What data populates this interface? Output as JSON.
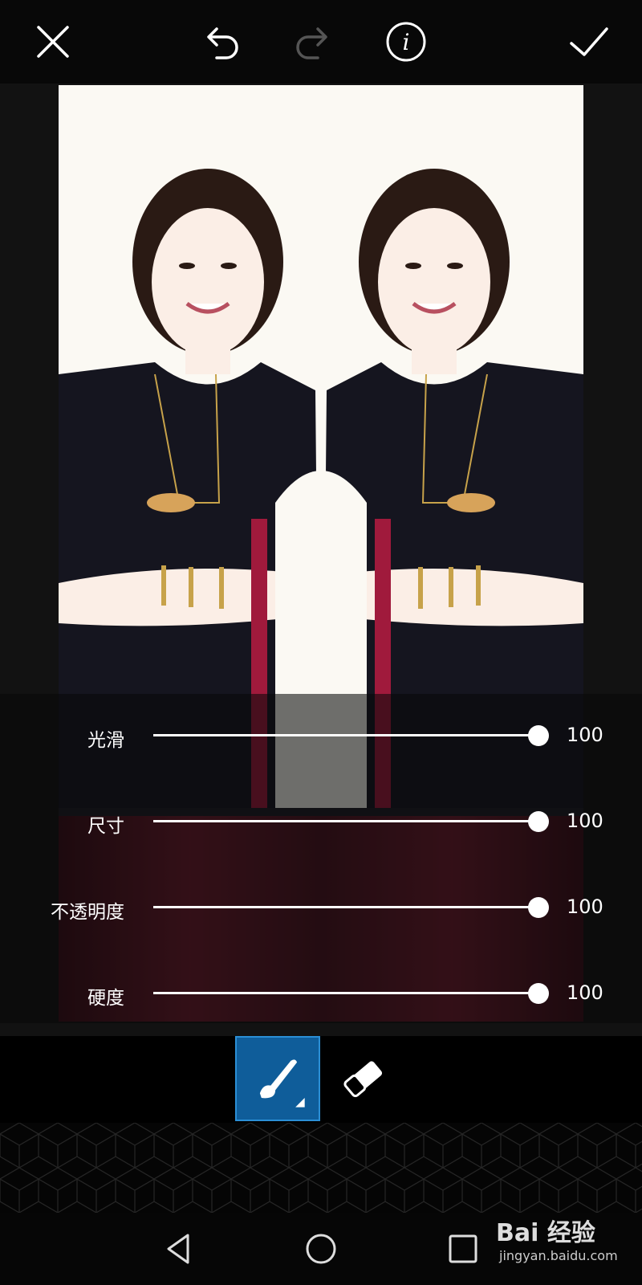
{
  "toolbar": {
    "close_icon": "close-icon",
    "undo_icon": "undo-icon",
    "redo_icon": "redo-icon",
    "info_icon": "info-icon",
    "apply_icon": "check-icon"
  },
  "sliders": [
    {
      "label": "光滑",
      "value": "100",
      "level": 1.0
    },
    {
      "label": "尺寸",
      "value": "100",
      "level": 1.0
    },
    {
      "label": "不透明度",
      "value": "100",
      "level": 1.0
    },
    {
      "label": "硬度",
      "value": "100",
      "level": 1.0
    }
  ],
  "tools": {
    "brush": {
      "icon": "brush-icon",
      "selected": true
    },
    "eraser": {
      "icon": "eraser-icon",
      "selected": false
    }
  },
  "navigation": {
    "back_icon": "back-triangle-icon",
    "home_icon": "home-circle-icon",
    "recents_icon": "recents-square-icon"
  },
  "watermark": {
    "text": "Bai 经验",
    "url": "jingyan.baidu.com"
  },
  "colors": {
    "accent": "#0f5d9a",
    "accent_border": "#2b8fd6",
    "background": "#0f0f0f"
  }
}
